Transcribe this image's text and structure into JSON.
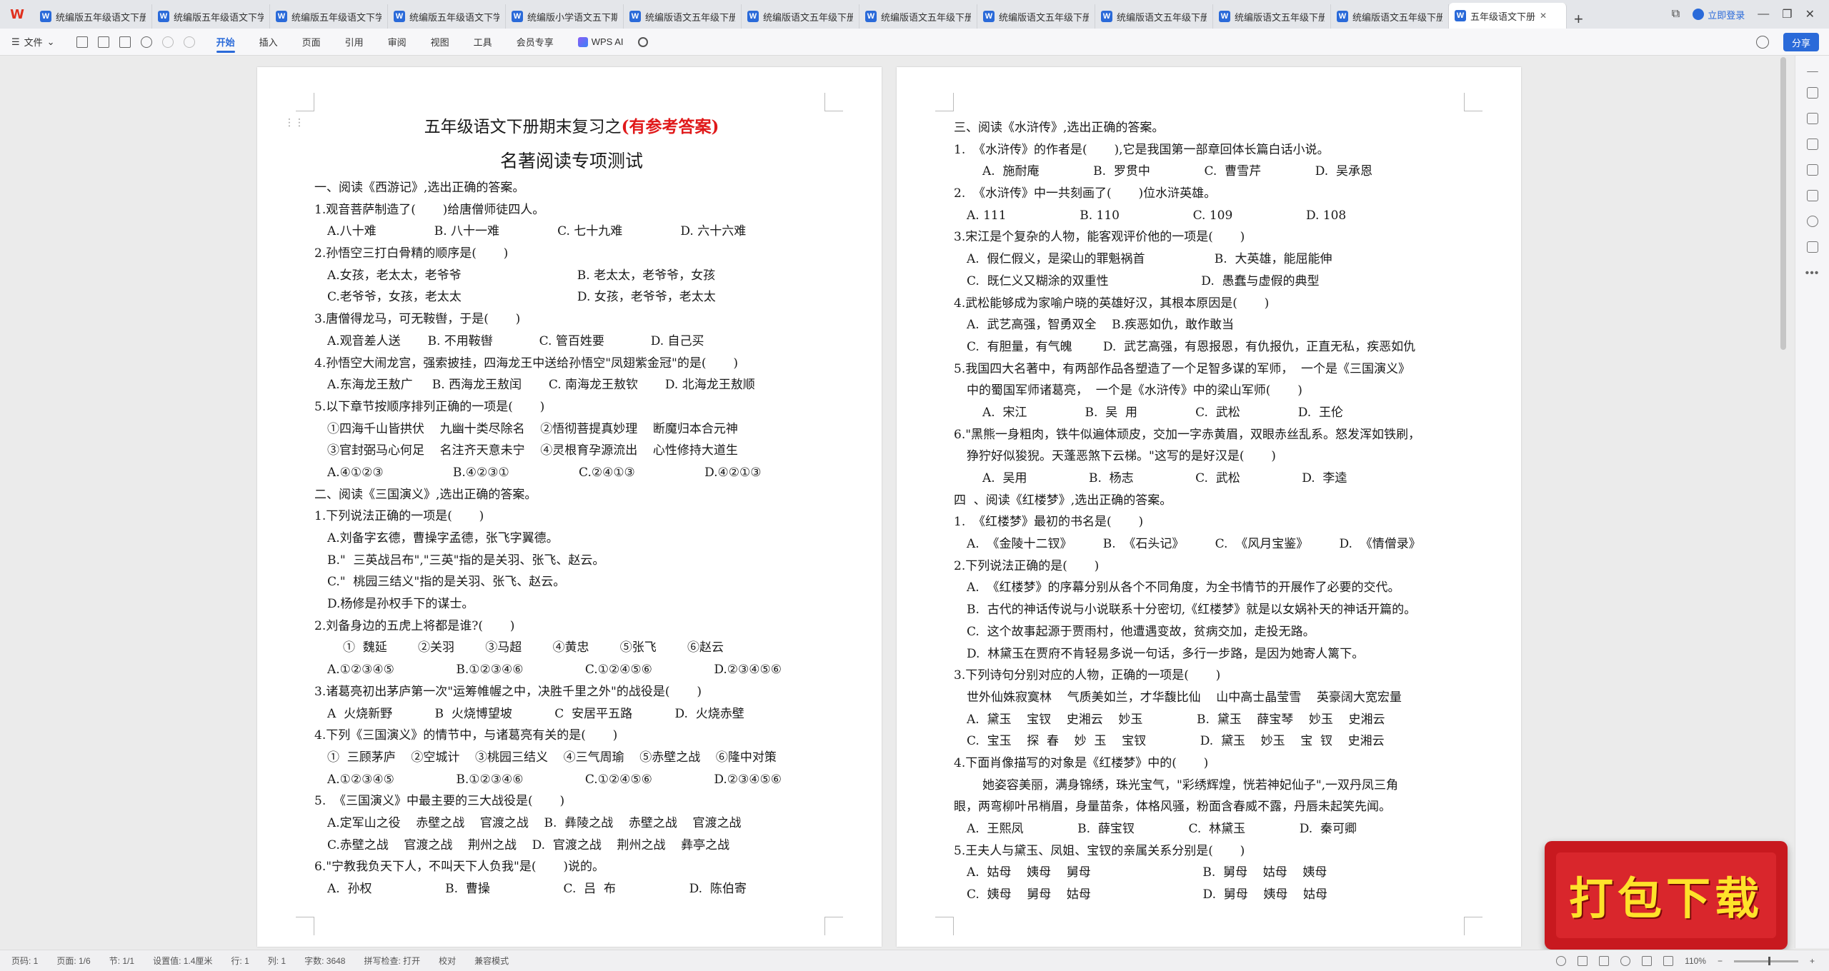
{
  "app": {
    "logo": "W"
  },
  "tabs": [
    {
      "label": "统编版五年级语文下册"
    },
    {
      "label": "统编版五年级语文下学"
    },
    {
      "label": "统编版五年级语文下学"
    },
    {
      "label": "统编版五年级语文下学"
    },
    {
      "label": "统编版小学语文五下期"
    },
    {
      "label": "统编版语文五年级下册"
    },
    {
      "label": "统编版语文五年级下册"
    },
    {
      "label": "统编版语文五年级下册"
    },
    {
      "label": "统编版语文五年级下册"
    },
    {
      "label": "统编版语文五年级下册"
    },
    {
      "label": "统编版语文五年级下册"
    },
    {
      "label": "统编版语文五年级下册"
    },
    {
      "label": "五年级语文下册"
    }
  ],
  "tabbar": {
    "login_label": "立即登录",
    "tab_icon": "W"
  },
  "toolbar": {
    "file_label": "文件",
    "menus": [
      "开始",
      "插入",
      "页面",
      "引用",
      "审阅",
      "视图",
      "工具",
      "会员专享"
    ],
    "wps_ai_label": "WPS AI",
    "share_label": "分享"
  },
  "page1": {
    "title_main": "五年级语文下册期末复习之",
    "title_red": "(有参考答案)",
    "subtitle": "名著阅读专项测试",
    "lines": [
      {
        "cls": "in1",
        "text": "一、阅读《西游记》,选出正确的答案。"
      },
      {
        "cls": "in1",
        "text": "1.观音菩萨制造了(       )给唐僧师徒四人。"
      },
      {
        "cls": "in2",
        "text": "A.八十难               B. 八十一难               C. 七十九难               D. 六十六难"
      },
      {
        "cls": "in1",
        "text": "2.孙悟空三打白骨精的顺序是(       )"
      },
      {
        "cls": "in2",
        "text": "A.女孩，老太太，老爷爷                              B. 老太太，老爷爷，女孩"
      },
      {
        "cls": "in2",
        "text": "C.老爷爷，女孩，老太太                              D. 女孩，老爷爷，老太太"
      },
      {
        "cls": "in1",
        "text": "3.唐僧得龙马，可无鞍辔，于是(       )"
      },
      {
        "cls": "in2",
        "text": "A.观音差人送       B. 不用鞍辔            C. 管百姓要            D. 自己买"
      },
      {
        "cls": "in1",
        "text": "4.孙悟空大闹龙宫，强索披挂，四海龙王中送给孙悟空\"凤翅紫金冠\"的是(       )"
      },
      {
        "cls": "in2",
        "text": "A.东海龙王敖广     B. 西海龙王敖闰       C. 南海龙王敖钦       D. 北海龙王敖顺"
      },
      {
        "cls": "in1",
        "text": "5.以下章节按顺序排列正确的一项是(       )"
      },
      {
        "cls": "in2",
        "text": "①四海千山皆拱伏    九幽十类尽除名    ②悟彻菩提真妙理    断魔归本合元神"
      },
      {
        "cls": "in2",
        "text": "③官封弼马心何足    名注齐天意未宁    ④灵根育孕源流出    心性修持大道生"
      },
      {
        "cls": "in2",
        "text": "A.④①②③                  B.④②③①                  C.②④①③                  D.④②①③"
      },
      {
        "cls": "in1",
        "text": "二、阅读《三国演义》,选出正确的答案。"
      },
      {
        "cls": "in1",
        "text": "1.下列说法正确的一项是(       )"
      },
      {
        "cls": "in2",
        "text": "A.刘备字玄德，曹操字孟德，张飞字翼德。"
      },
      {
        "cls": "in2",
        "text": "B.\"  三英战吕布\",\"三英\"指的是关羽、张飞、赵云。"
      },
      {
        "cls": "in2",
        "text": "C.\"  桃园三结义\"指的是关羽、张飞、赵云。"
      },
      {
        "cls": "in2",
        "text": "D.杨修是孙权手下的谋士。"
      },
      {
        "cls": "in1",
        "text": "2.刘备身边的五虎上将都是谁?(       )"
      },
      {
        "cls": "in3",
        "text": "①  魏延        ②关羽        ③马超        ④黄忠        ⑤张飞        ⑥赵云"
      },
      {
        "cls": "in2",
        "text": "A.①②③④⑤                B.①②③④⑥                C.①②④⑤⑥                D.②③④⑤⑥"
      },
      {
        "cls": "in1",
        "text": "3.诸葛亮初出茅庐第一次\"运筹帷幄之中，决胜千里之外\"的战役是(       )"
      },
      {
        "cls": "in2",
        "text": "A  火烧新野           B  火烧博望坡           C  安居平五路           D.  火烧赤壁"
      },
      {
        "cls": "in1",
        "text": "4.下列《三国演义》的情节中，与诸葛亮有关的是(       )"
      },
      {
        "cls": "in2",
        "text": "①  三顾茅庐    ②空城计    ③桃园三结义    ④三气周瑜    ⑤赤壁之战    ⑥隆中对策"
      },
      {
        "cls": "in2",
        "text": "A.①②③④⑤                B.①②③④⑥                C.①②④⑤⑥                D.②③④⑤⑥"
      },
      {
        "cls": "in1",
        "text": "5.  《三国演义》中最主要的三大战役是(       )"
      },
      {
        "cls": "in2",
        "text": "A.定军山之役    赤壁之战    官渡之战    B.  彝陵之战    赤壁之战    官渡之战"
      },
      {
        "cls": "in2",
        "text": "C.赤壁之战    官渡之战    荆州之战    D.  官渡之战    荆州之战    彝亭之战"
      },
      {
        "cls": "in1",
        "text": "6.\"宁教我负天下人，不叫天下人负我\"是(       )说的。"
      },
      {
        "cls": "in2",
        "text": "A.  孙权                   B.  曹操                   C.  吕  布                   D.  陈伯寄"
      }
    ]
  },
  "page2": {
    "lines": [
      {
        "cls": "in1",
        "text": "三、阅读《水浒传》,选出正确的答案。"
      },
      {
        "cls": "in1",
        "text": "1.  《水浒传》的作者是(       ),它是我国第一部章回体长篇白话小说。"
      },
      {
        "cls": "in3",
        "text": "A.  施耐庵              B.  罗贯中              C.  曹雪芹              D.  吴承恩"
      },
      {
        "cls": "in1",
        "text": "2.  《水浒传》中一共刻画了(       )位水浒英雄。"
      },
      {
        "cls": "in2",
        "text": "A. 111                   B. 110                   C. 109                   D. 108"
      },
      {
        "cls": "in1",
        "text": "3.宋江是个复杂的人物，能客观评价他的一项是(       )"
      },
      {
        "cls": "in2",
        "text": "A.  假仁假义，是梁山的罪魁祸首                  B.  大英雄，能屈能伸"
      },
      {
        "cls": "in2",
        "text": "C.  既仁义又糊涂的双重性                        D.  愚蠢与虚假的典型"
      },
      {
        "cls": "in1",
        "text": "4.武松能够成为家喻户晓的英雄好汉，其根本原因是(       )"
      },
      {
        "cls": "in2",
        "text": "A.  武艺高强，智勇双全    B.疾恶如仇，敢作敢当"
      },
      {
        "cls": "in2",
        "text": "C.  有胆量，有气魄        D.  武艺高强，有恩报恩，有仇报仇，正直无私，疾恶如仇"
      },
      {
        "cls": "in1",
        "text": "5.我国四大名著中，有两部作品各塑造了一个足智多谋的军师，  一个是《三国演义》"
      },
      {
        "cls": "in2",
        "text": "中的蜀国军师诸葛亮，  一个是《水浒传》中的梁山军师(       )"
      },
      {
        "cls": "in3",
        "text": "A.  宋江               B.  吴  用               C.  武松               D.  王伦"
      },
      {
        "cls": "in1",
        "text": "6.\"黑熊一身粗肉，铁牛似遍体顽皮，交加一字赤黄眉，双眼赤丝乱系。怒发浑如铁刷，"
      },
      {
        "cls": "in2",
        "text": "狰狞好似狻猊。天蓬恶煞下云梯。\"这写的是好汉是(       )"
      },
      {
        "cls": "in3",
        "text": "A.  吴用                B.  杨志                C.  武松                D.  李逵"
      },
      {
        "cls": "in1",
        "text": "四  、阅读《红楼梦》,选出正确的答案。"
      },
      {
        "cls": "in1",
        "text": "1.  《红楼梦》最初的书名是(       )"
      },
      {
        "cls": "in2",
        "text": "A.  《金陵十二钗》        B.  《石头记》        C.  《风月宝鉴》        D.  《情僧录》"
      },
      {
        "cls": "in1",
        "text": "2.下列说法正确的是(       )"
      },
      {
        "cls": "in2",
        "text": "A.  《红楼梦》的序幕分别从各个不同角度，为全书情节的开展作了必要的交代。"
      },
      {
        "cls": "in2",
        "text": "B.  古代的神话传说与小说联系十分密切,《红楼梦》就是以女娲补天的神话开篇的。"
      },
      {
        "cls": "in2",
        "text": "C.  这个故事起源于贾雨村，他遭遇变故，贫病交加，走投无路。"
      },
      {
        "cls": "in2",
        "text": "D.  林黛玉在贾府不肯轻易多说一句话，多行一步路，是因为她寄人篱下。"
      },
      {
        "cls": "in1",
        "text": "3.下列诗句分别对应的人物，正确的一项是(       )"
      },
      {
        "cls": "in2",
        "text": "世外仙姝寂寞林    气质美如兰，才华馥比仙    山中高士晶莹雪    英豪阔大宽宏量"
      },
      {
        "cls": "in2",
        "text": "A.  黛玉    宝钗    史湘云    妙玉              B.  黛玉    薛宝琴    妙玉    史湘云"
      },
      {
        "cls": "in2",
        "text": "C.  宝玉    探  春    妙  玉    宝钗              D.  黛玉    妙玉    宝  钗    史湘云"
      },
      {
        "cls": "in1",
        "text": "4.下面肖像描写的对象是《红楼梦》中的(       )"
      },
      {
        "cls": "in3",
        "text": "她姿容美丽，满身锦绣，珠光宝气，\"彩绣辉煌，恍若神妃仙子\",一双丹凤三角"
      },
      {
        "cls": "in1",
        "text": "眼，两弯柳叶吊梢眉，身量苗条，体格风骚，粉面含春威不露，丹唇未起笑先闻。"
      },
      {
        "cls": "in2",
        "text": "A.  王熙凤              B.  薛宝钗              C.  林黛玉              D.  秦可卿"
      },
      {
        "cls": "in1",
        "text": "5.王夫人与黛玉、凤姐、宝钗的亲属关系分别是(       )"
      },
      {
        "cls": "in2",
        "text": "A.  姑母    姨母    舅母                             B.  舅母    姑母    姨母"
      },
      {
        "cls": "in2",
        "text": "C.  姨母    舅母    姑母                             D.  舅母    姨母    姑母"
      }
    ]
  },
  "badge": {
    "text": "打包下载"
  },
  "statusbar": {
    "items": [
      "页码: 1",
      "页面: 1/6",
      "节: 1/1",
      "设置值: 1.4厘米",
      "行: 1",
      "列: 1",
      "字数: 3648",
      "拼写检查: 打开",
      "校对",
      "兼容模式"
    ],
    "zoom": "110%",
    "zoom_level": 0.55
  }
}
